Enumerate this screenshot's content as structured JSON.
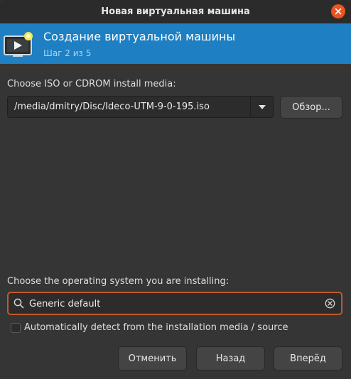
{
  "window": {
    "title": "Новая виртуальная машина"
  },
  "banner": {
    "title": "Создание виртуальной машины",
    "step": "Шаг 2 из 5"
  },
  "install_media": {
    "label": "Choose ISO or CDROM install media:",
    "path": "/media/dmitry/Disc/Ideco-UTM-9-0-195.iso",
    "browse_label": "Обзор..."
  },
  "os": {
    "label": "Choose the operating system you are installing:",
    "search_value": "Generic default",
    "autodetect_label": "Automatically detect from the installation media / source",
    "autodetect_checked": false
  },
  "footer": {
    "cancel_label": "Отменить",
    "back_label": "Назад",
    "forward_label": "Вперёд"
  },
  "colors": {
    "banner": "#1e7fc2",
    "close_button": "#e95420",
    "focus_border": "#c05a2b"
  }
}
